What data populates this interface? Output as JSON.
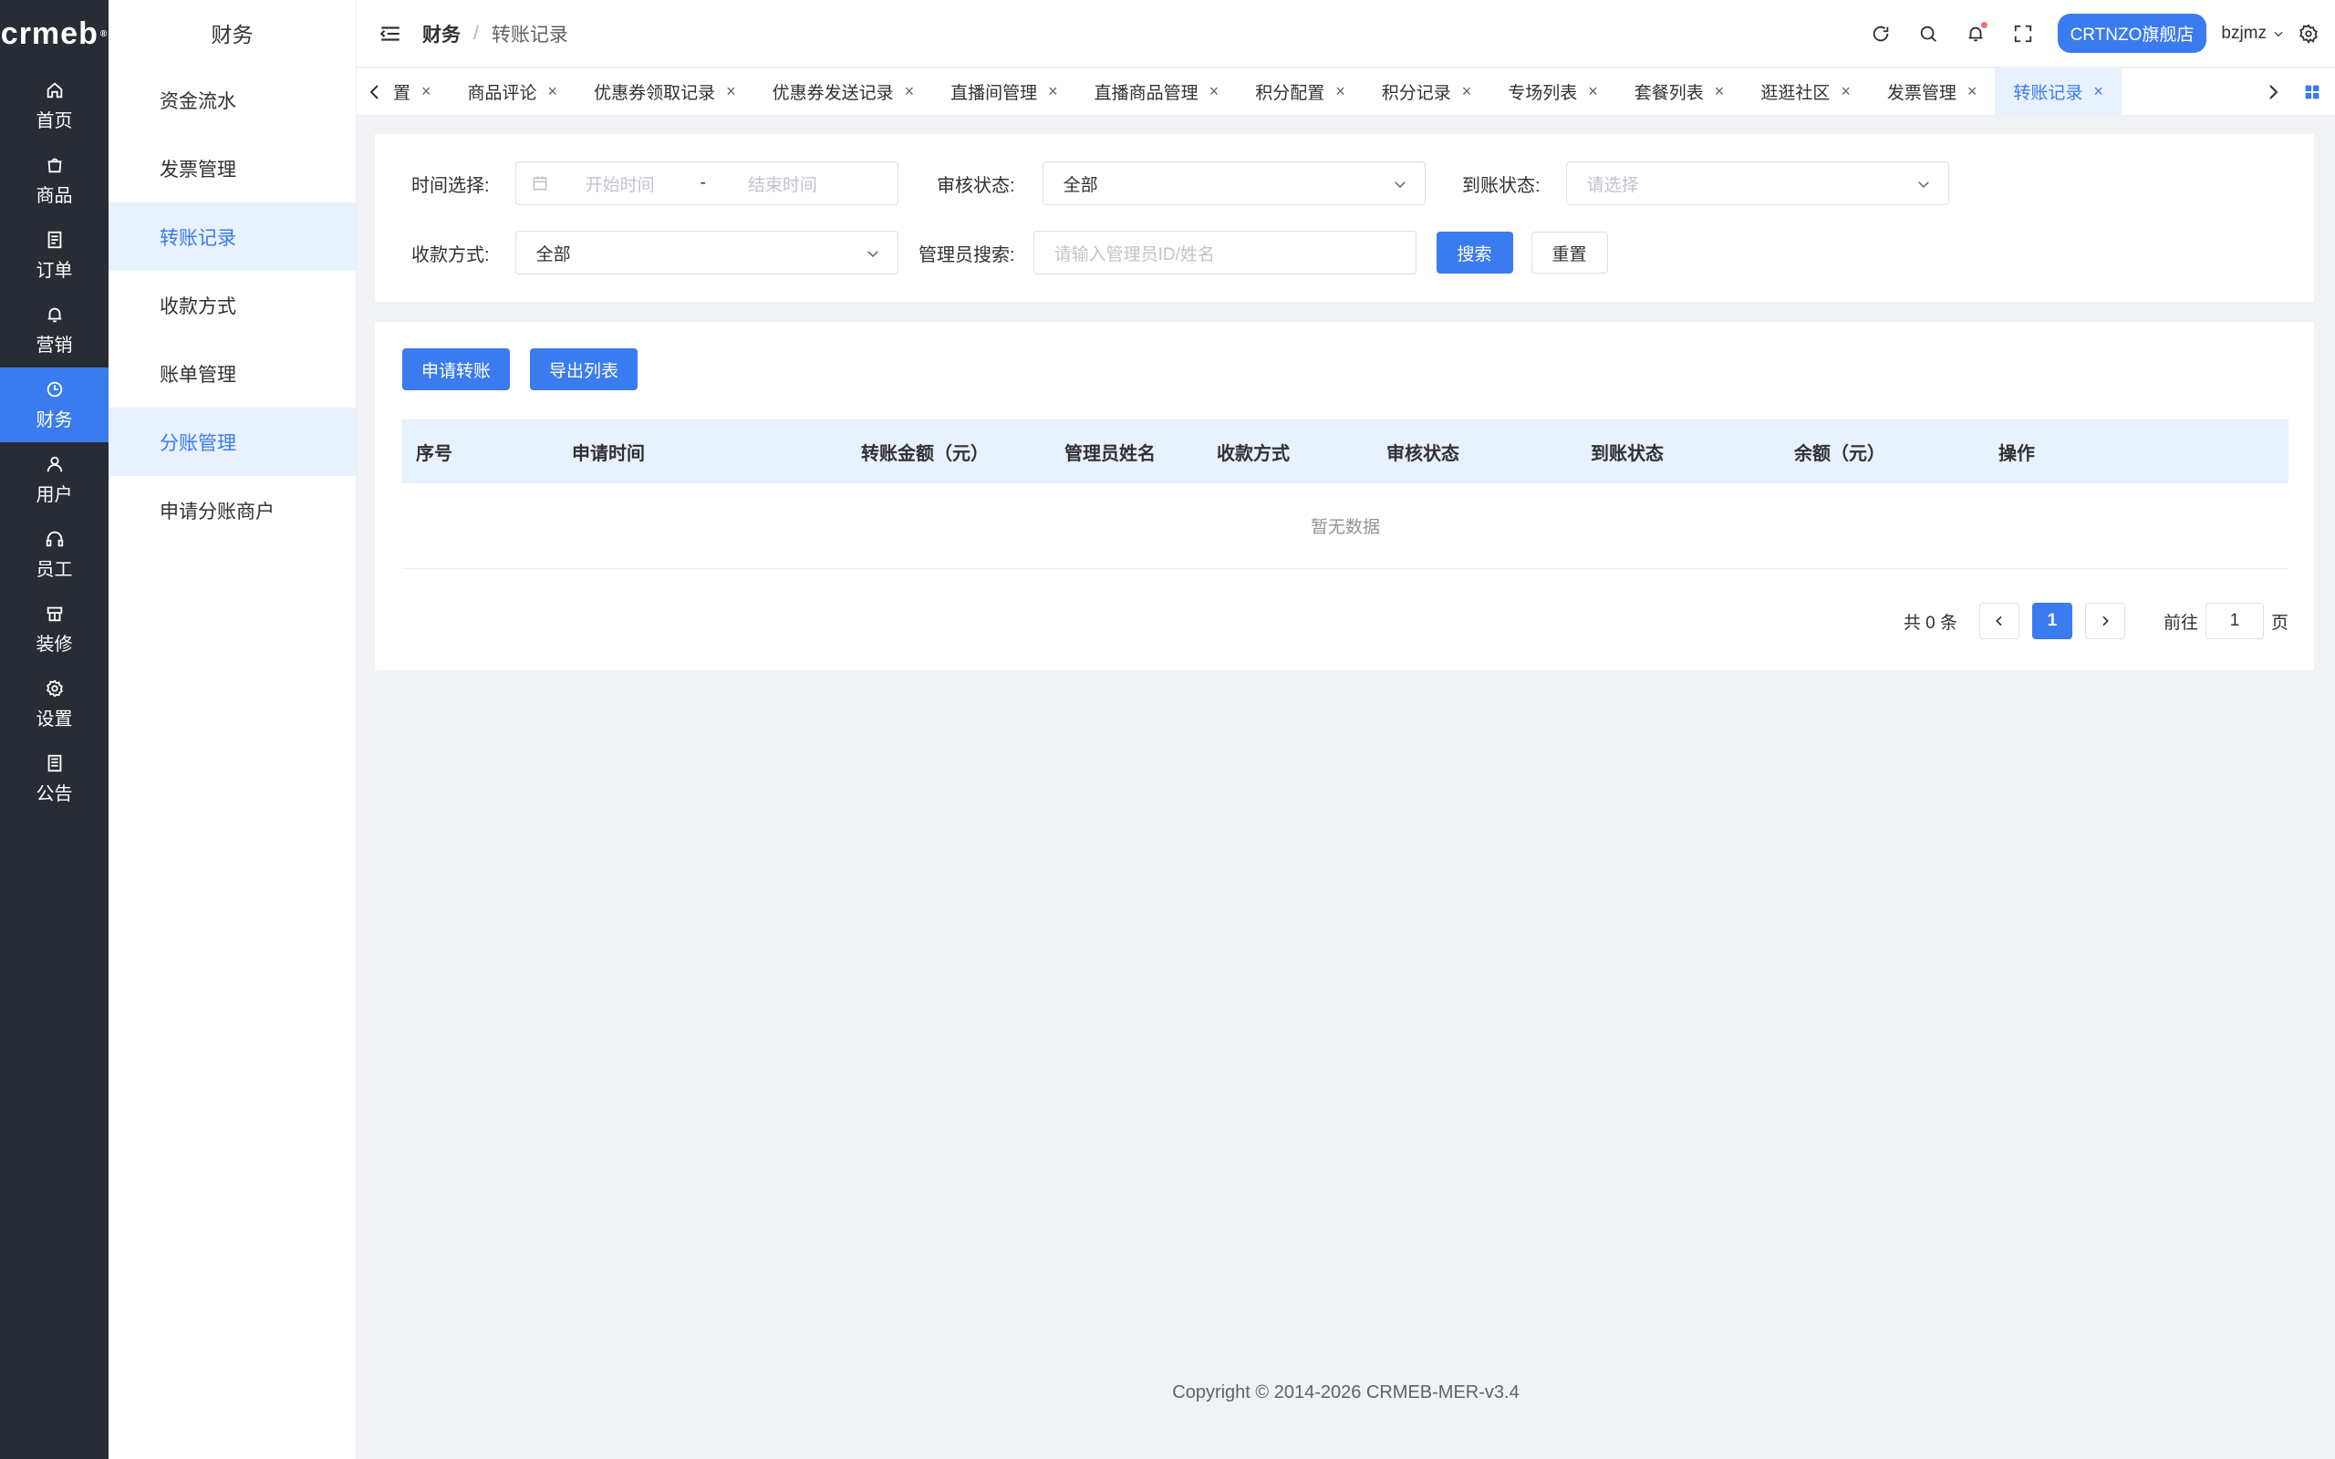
{
  "brand": {
    "logo_text": "crmeb",
    "logo_mark": "®"
  },
  "rail": [
    {
      "label": "首页",
      "icon": "home-icon"
    },
    {
      "label": "商品",
      "icon": "bag-icon"
    },
    {
      "label": "订单",
      "icon": "order-icon"
    },
    {
      "label": "营销",
      "icon": "bell-icon"
    },
    {
      "label": "财务",
      "icon": "clock-icon",
      "active": true
    },
    {
      "label": "用户",
      "icon": "user-icon"
    },
    {
      "label": "员工",
      "icon": "headset-icon"
    },
    {
      "label": "装修",
      "icon": "decor-icon"
    },
    {
      "label": "设置",
      "icon": "gear-icon"
    },
    {
      "label": "公告",
      "icon": "notice-icon"
    }
  ],
  "submenu": {
    "title": "财务",
    "items": [
      {
        "label": "资金流水"
      },
      {
        "label": "发票管理"
      },
      {
        "label": "转账记录",
        "active": true
      },
      {
        "label": "收款方式"
      },
      {
        "label": "账单管理"
      },
      {
        "label": "分账管理",
        "highlight": true
      },
      {
        "label": "申请分账商户"
      }
    ]
  },
  "header": {
    "breadcrumb_root": "财务",
    "breadcrumb_sep": "/",
    "breadcrumb_current": "转账记录",
    "store_name": "CRTNZO旗舰店",
    "username": "bzjmz"
  },
  "tabs": [
    {
      "label": "置"
    },
    {
      "label": "商品评论"
    },
    {
      "label": "优惠券领取记录"
    },
    {
      "label": "优惠券发送记录"
    },
    {
      "label": "直播间管理"
    },
    {
      "label": "直播商品管理"
    },
    {
      "label": "积分配置"
    },
    {
      "label": "积分记录"
    },
    {
      "label": "专场列表"
    },
    {
      "label": "套餐列表"
    },
    {
      "label": "逛逛社区"
    },
    {
      "label": "发票管理"
    },
    {
      "label": "转账记录",
      "active": true
    }
  ],
  "tab_close": "×",
  "filters": {
    "time_label": "时间选择:",
    "start_placeholder": "开始时间",
    "range_sep": "-",
    "end_placeholder": "结束时间",
    "audit_label": "审核状态:",
    "audit_value": "全部",
    "arrive_label": "到账状态:",
    "arrive_placeholder": "请选择",
    "pay_label": "收款方式:",
    "pay_value": "全部",
    "admin_label": "管理员搜索:",
    "admin_placeholder": "请输入管理员ID/姓名",
    "search_btn": "搜索",
    "reset_btn": "重置"
  },
  "actions": {
    "apply_btn": "申请转账",
    "export_btn": "导出列表"
  },
  "table": {
    "columns": [
      "序号",
      "申请时间",
      "转账金额（元）",
      "管理员姓名",
      "收款方式",
      "审核状态",
      "到账状态",
      "余额（元）",
      "操作"
    ],
    "empty_text": "暂无数据"
  },
  "pagination": {
    "total_text": "共 0 条",
    "current_page": "1",
    "goto_label": "前往",
    "goto_value": "1",
    "page_suffix": "页"
  },
  "footer": {
    "copyright": "Copyright © 2014-2026 CRMEB-MER-v3.4"
  },
  "colors": {
    "primary": "#3a7bf0",
    "rail_bg": "#282c34",
    "active_bg": "#e8f1fe"
  }
}
